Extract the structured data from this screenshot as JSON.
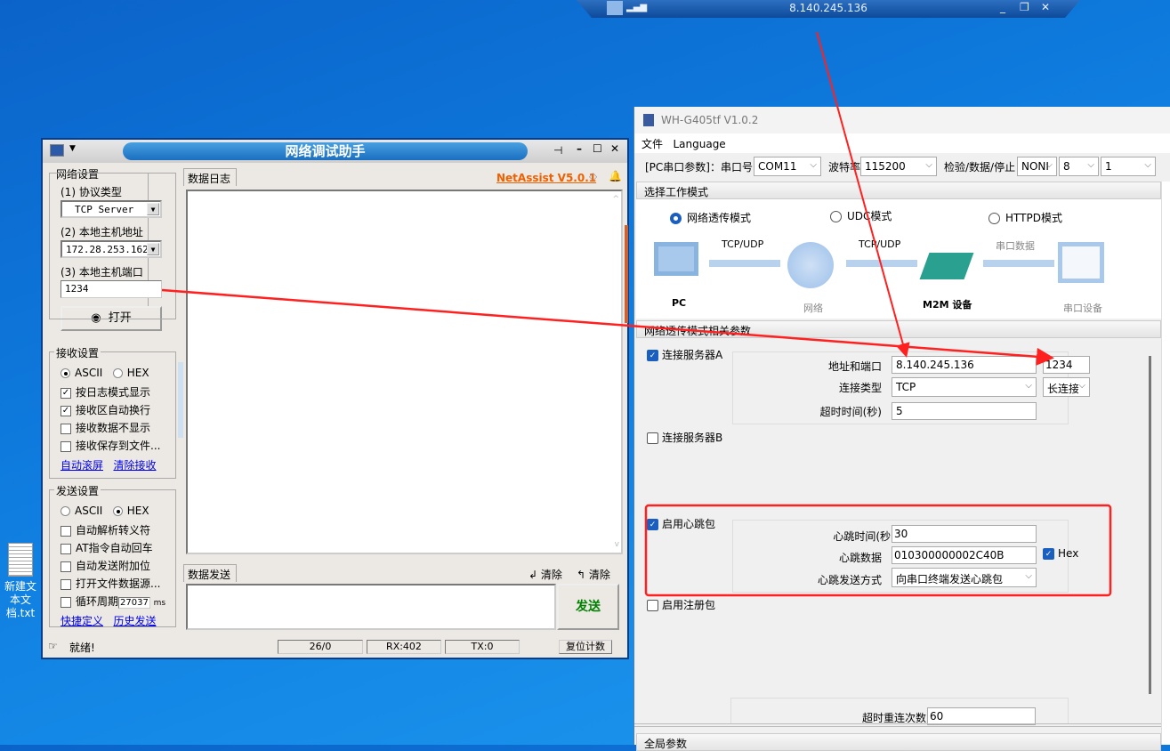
{
  "remote": {
    "host": "8.140.245.136"
  },
  "desktop": {
    "file": "新建文本文档.txt"
  },
  "netassist": {
    "title": "网络调试助手",
    "version": "NetAssist V5.0.1",
    "net": {
      "legend": "网络设置",
      "proto_label": "(1) 协议类型",
      "proto": "TCP Server",
      "ip_label": "(2) 本地主机地址",
      "ip": "172.28.253.162",
      "port_label": "(3) 本地主机端口",
      "port": "1234",
      "open": "打开"
    },
    "recv": {
      "legend": "接收设置",
      "ascii": "ASCII",
      "hex": "HEX",
      "opts": [
        "按日志模式显示",
        "接收区自动换行",
        "接收数据不显示",
        "接收保存到文件..."
      ],
      "links": [
        "自动滚屏",
        "清除接收"
      ]
    },
    "send": {
      "legend": "发送设置",
      "ascii": "ASCII",
      "hex": "HEX",
      "opts": [
        "自动解析转义符",
        "AT指令自动回车",
        "自动发送附加位",
        "打开文件数据源...",
        "循环周期"
      ],
      "period": "27037",
      "unit": "ms",
      "links": [
        "快捷定义",
        "历史发送"
      ]
    },
    "log_tab": "数据日志",
    "send_tab": "数据发送",
    "clear1": "清除",
    "clear2": "清除",
    "send_btn": "发送",
    "status": {
      "ready": "就绪!",
      "count": "26/0",
      "rx": "RX:402",
      "tx": "TX:0",
      "reset": "复位计数"
    }
  },
  "wh": {
    "title": "WH-G405tf V1.0.2",
    "menu": [
      "文件",
      "Language"
    ],
    "serial": {
      "label": "[PC串口参数]：串口号",
      "port": "COM11",
      "baud_label": "波特率",
      "baud": "115200",
      "parity_label": "检验/数据/停止",
      "parity": "NONI",
      "data": "8",
      "stop": "1"
    },
    "mode_header": "选择工作模式",
    "modes": [
      "网络透传模式",
      "UDC模式",
      "HTTPD模式"
    ],
    "diagram": {
      "pc": "PC",
      "net": "网络",
      "m2m": "M2M 设备",
      "serial_dev": "串口设备",
      "l1": "TCP/UDP",
      "l2": "TCP/UDP",
      "l3": "串口数据"
    },
    "params_header": "网络透传模式相关参数",
    "serverA": {
      "label": "连接服务器A",
      "addr_label": "地址和端口",
      "addr": "8.140.245.136",
      "port": "1234",
      "type_label": "连接类型",
      "type": "TCP",
      "conn": "长连接",
      "timeout_label": "超时时间(秒)",
      "timeout": "5"
    },
    "serverB": {
      "label": "连接服务器B"
    },
    "heartbeat": {
      "label": "启用心跳包",
      "time_label": "心跳时间(秒",
      "time": "30",
      "data_label": "心跳数据",
      "data": "010300000002C40B",
      "hex": "Hex",
      "mode_label": "心跳发送方式",
      "mode": "向串口终端发送心跳包"
    },
    "register": {
      "label": "启用注册包"
    },
    "retry_label": "超时重连次数",
    "retry": "60",
    "global_header": "全局参数"
  }
}
